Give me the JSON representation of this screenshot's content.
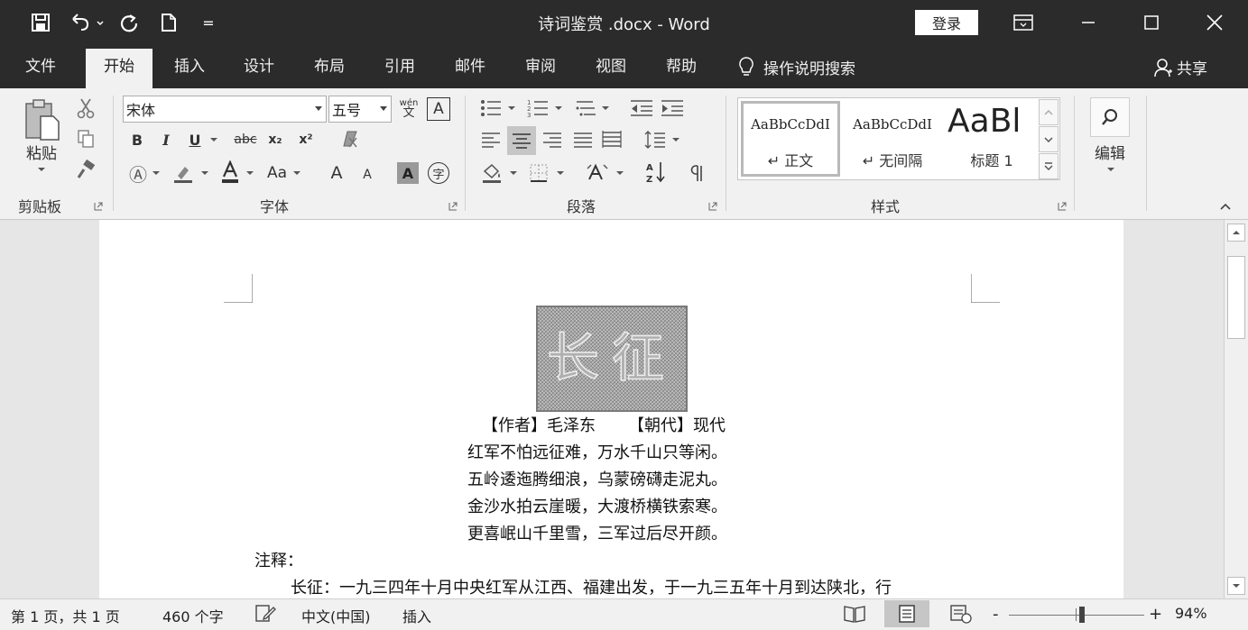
{
  "titlebar": {
    "doc_title": "诗词鉴赏 .docx - Word",
    "login_label": "登录",
    "qa_customize": "="
  },
  "menu": {
    "tabs": [
      "文件",
      "开始",
      "插入",
      "设计",
      "布局",
      "引用",
      "邮件",
      "审阅",
      "视图",
      "帮助"
    ],
    "active_tab": "开始",
    "tell_me": "操作说明搜索",
    "share": "共享"
  },
  "ribbon": {
    "clipboard": {
      "label": "剪贴板",
      "paste": "粘贴"
    },
    "font": {
      "label": "字体",
      "font_name": "宋体",
      "font_size": "五号",
      "bold": "B",
      "italic": "I",
      "underline": "U",
      "strike": "abc",
      "subscript": "x₂",
      "superscript": "x²",
      "case": "Aa",
      "grow": "A",
      "shrink": "A",
      "pinyin_top": "wén",
      "pinyin_bottom": "文",
      "char_border": "A",
      "enclose": "字"
    },
    "paragraph": {
      "label": "段落"
    },
    "styles": {
      "label": "样式",
      "items": [
        {
          "sample": "AaBbCcDdI",
          "name": "正文"
        },
        {
          "sample": "AaBbCcDdI",
          "name": "无间隔"
        },
        {
          "sample": "AaBl",
          "name": "标题 1"
        }
      ]
    },
    "editing": {
      "label": "编辑"
    }
  },
  "document": {
    "title_art": "长征",
    "byline_author_label": "【作者】",
    "byline_author": "毛泽东",
    "byline_dynasty_label": "【朝代】",
    "byline_dynasty": "现代",
    "poem_lines": [
      "红军不怕远征难，万水千山只等闲。",
      "五岭逶迤腾细浪，乌蒙磅礴走泥丸。",
      "金沙水拍云崖暖，大渡桥横铁索寒。",
      "更喜岷山千里雪，三军过后尽开颜。"
    ],
    "notes_heading": "注释：",
    "note_line": "长征：一九三四年十月中央红军从江西、福建出发，于一九三五年十月到达陕北，行"
  },
  "statusbar": {
    "page": "第 1 页，共 1 页",
    "words": "460 个字",
    "language": "中文(中国)",
    "mode": "插入",
    "zoom": "94%",
    "zoom_minus": "-",
    "zoom_plus": "+",
    "zoom_level": 0.54
  },
  "colors": {
    "titlebar": "#2b2b2b",
    "ribbon": "#f1f1f1",
    "page": "#ffffff"
  }
}
